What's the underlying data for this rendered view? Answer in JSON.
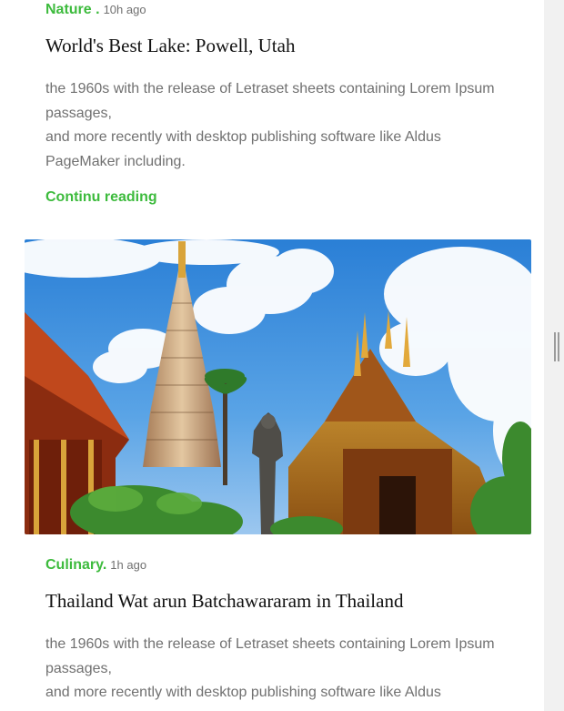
{
  "posts": [
    {
      "category": "Nature .",
      "time": "10h ago",
      "title": "World's Best Lake: Powell, Utah",
      "excerpt": [
        "the 1960s with the release of Letraset sheets containing Lorem Ipsum passages,",
        "and more recently with desktop publishing software like Aldus PageMaker including."
      ],
      "read_more": "Continu reading"
    },
    {
      "category": "Culinary.",
      "time": "1h ago",
      "title": "Thailand Wat arun Batchawararam in Thailand",
      "excerpt": [
        "the 1960s with the release of Letraset sheets containing Lorem Ipsum passages,",
        "and more recently with desktop publishing software like Aldus"
      ]
    }
  ],
  "colors": {
    "accent": "#3dbb3d",
    "text_muted": "#707070",
    "title": "#111111",
    "scrollbar": "#f1f1f1"
  },
  "icons": {
    "scrollbar_grip": "scrollbar-grip-icon"
  }
}
